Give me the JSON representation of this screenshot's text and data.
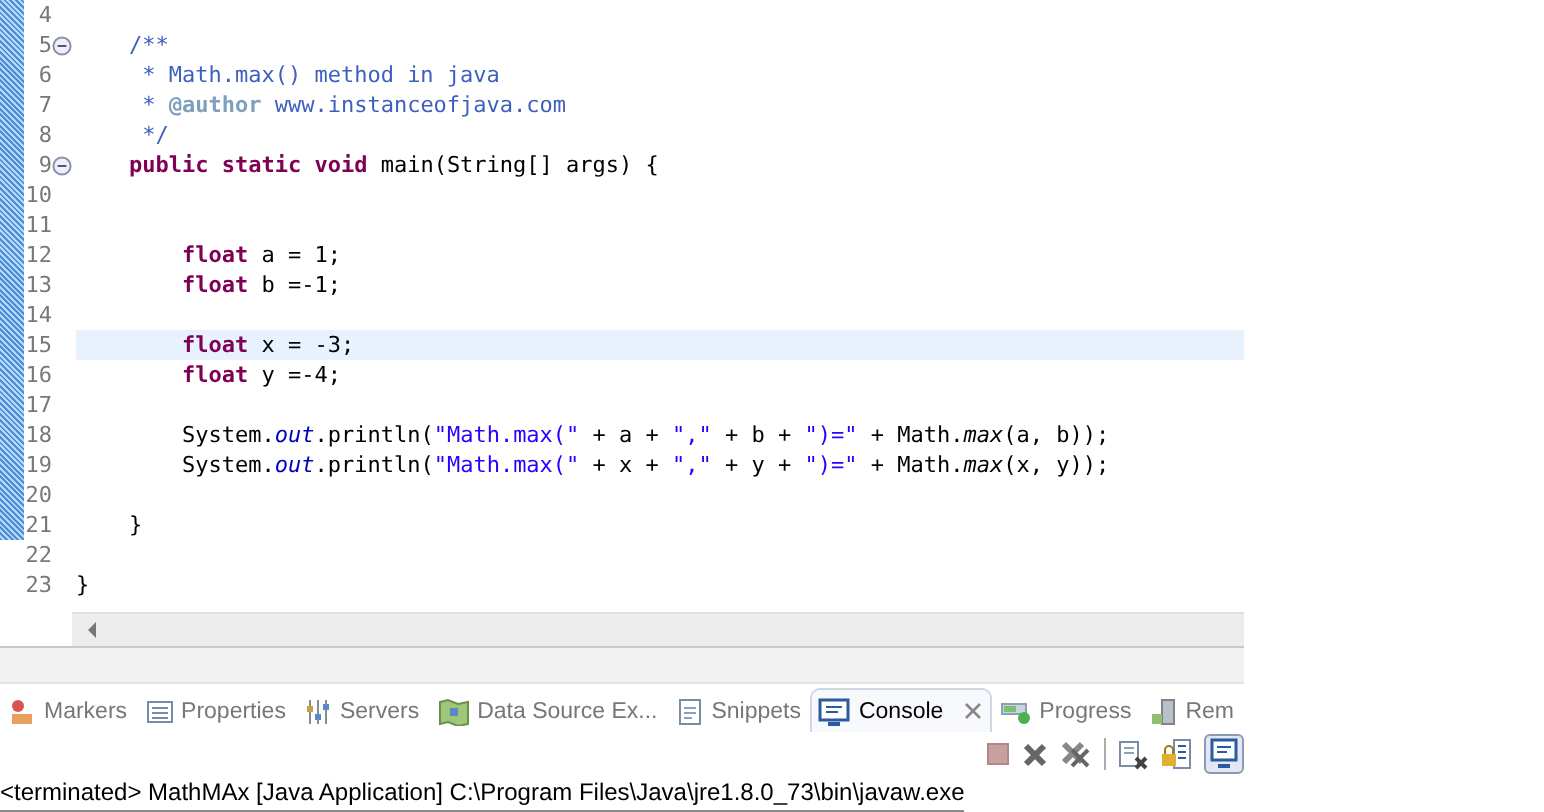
{
  "editor": {
    "lines": [
      {
        "number": "4",
        "fold": false,
        "highlighted": false
      },
      {
        "number": "5",
        "fold": true,
        "highlighted": false,
        "tokens": [
          {
            "kind": "doc",
            "text": "    /**"
          }
        ]
      },
      {
        "number": "6",
        "fold": false,
        "highlighted": false,
        "tokens": [
          {
            "kind": "doc",
            "text": "     * Math.max() method in java"
          }
        ]
      },
      {
        "number": "7",
        "fold": false,
        "highlighted": false,
        "tokens": [
          {
            "kind": "doc",
            "text": "     * "
          },
          {
            "kind": "doctag",
            "text": "@author"
          },
          {
            "kind": "doc",
            "text": " www.instanceofjava.com"
          }
        ]
      },
      {
        "number": "8",
        "fold": false,
        "highlighted": false,
        "tokens": [
          {
            "kind": "doc",
            "text": "     */"
          }
        ]
      },
      {
        "number": "9",
        "fold": true,
        "highlighted": false,
        "tokens": [
          {
            "kind": "keyword",
            "text": "    public static void"
          },
          {
            "kind": "plain",
            "text": " main(String[] args) {"
          }
        ]
      },
      {
        "number": "10",
        "fold": false,
        "highlighted": false
      },
      {
        "number": "11",
        "fold": false,
        "highlighted": false
      },
      {
        "number": "12",
        "fold": false,
        "highlighted": false,
        "tokens": [
          {
            "kind": "keyword",
            "text": "        float"
          },
          {
            "kind": "plain",
            "text": " a = 1;"
          }
        ]
      },
      {
        "number": "13",
        "fold": false,
        "highlighted": false,
        "tokens": [
          {
            "kind": "keyword",
            "text": "        float"
          },
          {
            "kind": "plain",
            "text": " b =-1;"
          }
        ]
      },
      {
        "number": "14",
        "fold": false,
        "highlighted": false
      },
      {
        "number": "15",
        "fold": false,
        "highlighted": true,
        "tokens": [
          {
            "kind": "keyword",
            "text": "        float"
          },
          {
            "kind": "plain",
            "text": " x = -3;"
          }
        ]
      },
      {
        "number": "16",
        "fold": false,
        "highlighted": false,
        "tokens": [
          {
            "kind": "keyword",
            "text": "        float"
          },
          {
            "kind": "plain",
            "text": " y =-4;"
          }
        ]
      },
      {
        "number": "17",
        "fold": false,
        "highlighted": false
      },
      {
        "number": "18",
        "fold": false,
        "highlighted": false,
        "tokens": [
          {
            "kind": "plain",
            "text": "        System."
          },
          {
            "kind": "field",
            "text": "out"
          },
          {
            "kind": "plain",
            "text": ".println("
          },
          {
            "kind": "string",
            "text": "\"Math.max(\""
          },
          {
            "kind": "plain",
            "text": " + a + "
          },
          {
            "kind": "string",
            "text": "\",\""
          },
          {
            "kind": "plain",
            "text": " + b + "
          },
          {
            "kind": "string",
            "text": "\")=\""
          },
          {
            "kind": "plain",
            "text": " + Math."
          },
          {
            "kind": "static",
            "text": "max"
          },
          {
            "kind": "plain",
            "text": "(a, b));"
          }
        ]
      },
      {
        "number": "19",
        "fold": false,
        "highlighted": false,
        "tokens": [
          {
            "kind": "plain",
            "text": "        System."
          },
          {
            "kind": "field",
            "text": "out"
          },
          {
            "kind": "plain",
            "text": ".println("
          },
          {
            "kind": "string",
            "text": "\"Math.max(\""
          },
          {
            "kind": "plain",
            "text": " + x + "
          },
          {
            "kind": "string",
            "text": "\",\""
          },
          {
            "kind": "plain",
            "text": " + y + "
          },
          {
            "kind": "string",
            "text": "\")=\""
          },
          {
            "kind": "plain",
            "text": " + Math."
          },
          {
            "kind": "static",
            "text": "max"
          },
          {
            "kind": "plain",
            "text": "(x, y));"
          }
        ]
      },
      {
        "number": "20",
        "fold": false,
        "highlighted": false
      },
      {
        "number": "21",
        "fold": false,
        "highlighted": false,
        "tokens": [
          {
            "kind": "plain",
            "text": "    }"
          }
        ]
      },
      {
        "number": "22",
        "fold": false,
        "highlighted": false
      },
      {
        "number": "23",
        "fold": false,
        "highlighted": false,
        "tokens": [
          {
            "kind": "plain",
            "text": "}"
          }
        ]
      }
    ]
  },
  "bottom_panel": {
    "tabs": [
      {
        "label": "Markers",
        "kind": "markers",
        "selected": false
      },
      {
        "label": "Properties",
        "kind": "properties",
        "selected": false
      },
      {
        "label": "Servers",
        "kind": "servers",
        "selected": false
      },
      {
        "label": "Data Source Ex...",
        "kind": "datasource",
        "selected": false
      },
      {
        "label": "Snippets",
        "kind": "snippets",
        "selected": false
      },
      {
        "label": "Console",
        "kind": "console",
        "selected": true
      },
      {
        "label": "Progress",
        "kind": "progress",
        "selected": false
      },
      {
        "label": "Rem",
        "kind": "remote",
        "selected": false
      }
    ],
    "console_status": "<terminated> MathMAx [Java Application] C:\\Program Files\\Java\\jre1.8.0_73\\bin\\javaw.exe"
  }
}
